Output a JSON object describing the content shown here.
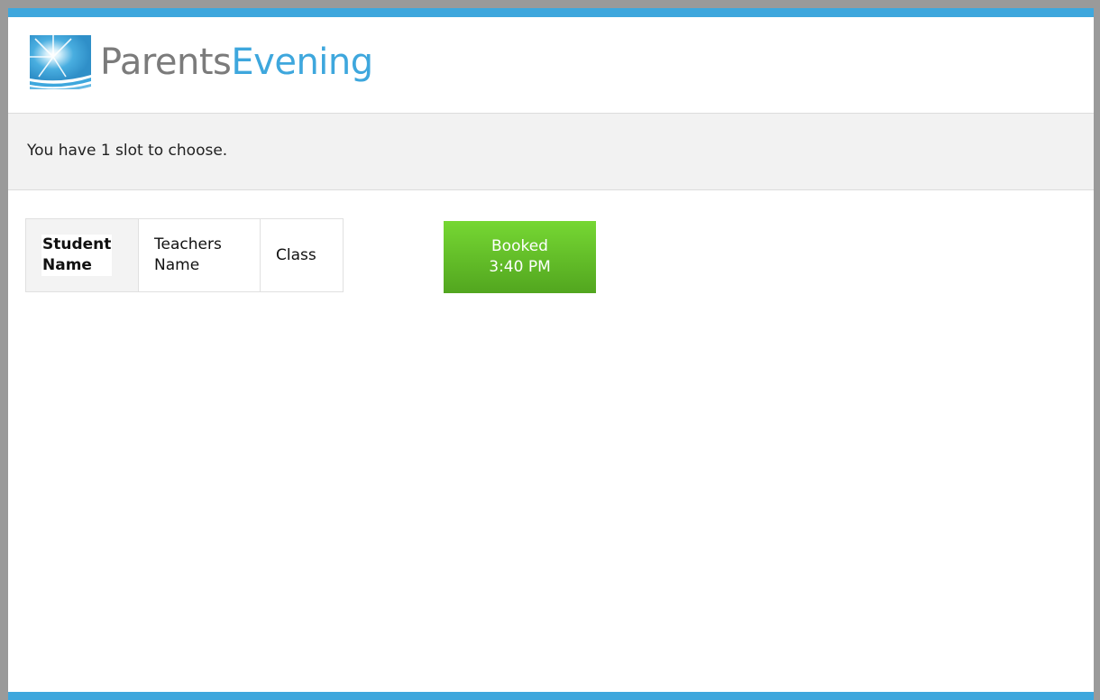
{
  "brand": {
    "name_part1": "Parents",
    "name_part2": "Evening",
    "accent_color": "#3ea7dd",
    "text_color": "#7b7b7b",
    "logo_icon": "sunburst-logo-icon"
  },
  "notice": {
    "message": "You have 1 slot to choose."
  },
  "appointment": {
    "student_label": "Student Name",
    "student_label_line1": "Student",
    "student_label_line2": "Name",
    "teacher_label_line1": "Teachers",
    "teacher_label_line2": "Name",
    "class_label": "Class"
  },
  "slot": {
    "status": "Booked",
    "time": "3:40 PM",
    "color": "#5cb82a"
  }
}
